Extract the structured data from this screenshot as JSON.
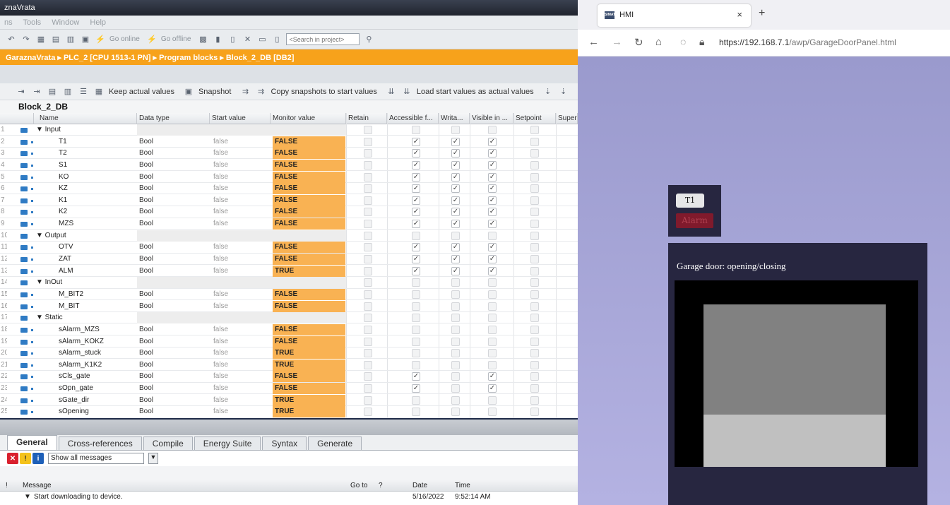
{
  "tia": {
    "title": "znaVrata",
    "menu": [
      "ns",
      "Tools",
      "Window",
      "Help"
    ],
    "toolbar": {
      "go_online": "Go online",
      "go_offline": "Go offline",
      "search_placeholder": "<Search in project>"
    },
    "breadcrumb": "GaraznaVrata  ▸  PLC_2 [CPU 1513-1 PN]  ▸  Program blocks  ▸  Block_2_DB [DB2]",
    "toolbar2": {
      "keep": "Keep actual values",
      "snapshot": "Snapshot",
      "copy": "Copy snapshots to start values",
      "load": "Load start values as actual values"
    },
    "block_name": "Block_2_DB",
    "columns": [
      "Name",
      "Data type",
      "Start value",
      "Monitor value",
      "Retain",
      "Accessible f...",
      "Writa...",
      "Visible in ...",
      "Setpoint",
      "Super"
    ],
    "rows": [
      {
        "n": "1",
        "name": "▼  Input",
        "group": true
      },
      {
        "n": "2",
        "name": "T1",
        "type": "Bool",
        "start": "false",
        "mon": "FALSE",
        "acc": true,
        "wr": true,
        "vis": true
      },
      {
        "n": "3",
        "name": "T2",
        "type": "Bool",
        "start": "false",
        "mon": "FALSE",
        "acc": true,
        "wr": true,
        "vis": true
      },
      {
        "n": "4",
        "name": "S1",
        "type": "Bool",
        "start": "false",
        "mon": "FALSE",
        "acc": true,
        "wr": true,
        "vis": true
      },
      {
        "n": "5",
        "name": "KO",
        "type": "Bool",
        "start": "false",
        "mon": "FALSE",
        "acc": true,
        "wr": true,
        "vis": true
      },
      {
        "n": "6",
        "name": "KZ",
        "type": "Bool",
        "start": "false",
        "mon": "FALSE",
        "acc": true,
        "wr": true,
        "vis": true
      },
      {
        "n": "7",
        "name": "K1",
        "type": "Bool",
        "start": "false",
        "mon": "FALSE",
        "acc": true,
        "wr": true,
        "vis": true
      },
      {
        "n": "8",
        "name": "K2",
        "type": "Bool",
        "start": "false",
        "mon": "FALSE",
        "acc": true,
        "wr": true,
        "vis": true
      },
      {
        "n": "9",
        "name": "MZS",
        "type": "Bool",
        "start": "false",
        "mon": "FALSE",
        "acc": true,
        "wr": true,
        "vis": true
      },
      {
        "n": "10",
        "name": "▼  Output",
        "group": true
      },
      {
        "n": "11",
        "name": "OTV",
        "type": "Bool",
        "start": "false",
        "mon": "FALSE",
        "acc": true,
        "wr": true,
        "vis": true
      },
      {
        "n": "12",
        "name": "ZAT",
        "type": "Bool",
        "start": "false",
        "mon": "FALSE",
        "acc": true,
        "wr": true,
        "vis": true
      },
      {
        "n": "13",
        "name": "ALM",
        "type": "Bool",
        "start": "false",
        "mon": "TRUE",
        "acc": true,
        "wr": true,
        "vis": true
      },
      {
        "n": "14",
        "name": "▼  InOut",
        "group": true
      },
      {
        "n": "15",
        "name": "M_BIT2",
        "type": "Bool",
        "start": "false",
        "mon": "FALSE"
      },
      {
        "n": "16",
        "name": "M_BIT",
        "type": "Bool",
        "start": "false",
        "mon": "FALSE"
      },
      {
        "n": "17",
        "name": "▼  Static",
        "group": true
      },
      {
        "n": "18",
        "name": "sAlarm_MZS",
        "type": "Bool",
        "start": "false",
        "mon": "FALSE"
      },
      {
        "n": "19",
        "name": "sAlarm_KOKZ",
        "type": "Bool",
        "start": "false",
        "mon": "FALSE"
      },
      {
        "n": "20",
        "name": "sAlarm_stuck",
        "type": "Bool",
        "start": "false",
        "mon": "TRUE"
      },
      {
        "n": "21",
        "name": "sAlarm_K1K2",
        "type": "Bool",
        "start": "false",
        "mon": "TRUE"
      },
      {
        "n": "22",
        "name": "sCls_gate",
        "type": "Bool",
        "start": "false",
        "mon": "FALSE",
        "acc": true,
        "vis": true
      },
      {
        "n": "23",
        "name": "sOpn_gate",
        "type": "Bool",
        "start": "false",
        "mon": "FALSE",
        "acc": true,
        "vis": true
      },
      {
        "n": "24",
        "name": "sGate_dir",
        "type": "Bool",
        "start": "false",
        "mon": "TRUE"
      },
      {
        "n": "25",
        "name": "sOpening",
        "type": "Bool",
        "start": "false",
        "mon": "TRUE"
      }
    ],
    "tabs": [
      "General",
      "Cross-references",
      "Compile",
      "Energy Suite",
      "Syntax",
      "Generate"
    ],
    "filter": "Show all messages",
    "msg_head": {
      "bang": "!",
      "message": "Message",
      "goto": "Go to",
      "q": "?",
      "date": "Date",
      "time": "Time"
    },
    "msg_row": {
      "text": "Start downloading to device.",
      "date": "5/16/2022",
      "time": "9:52:14 AM"
    }
  },
  "browser": {
    "tab_title": "HMI",
    "favicon": "SIMATIC",
    "close": "×",
    "new_tab": "+",
    "url_main": "https://192.168.7.1",
    "url_path": "/awp/GarageDoorPanel.html"
  },
  "hmi": {
    "t1_label": "T1",
    "alarm_label": "Alarm",
    "status_text": "Garage door: opening/closing",
    "colors": {
      "panel": "#272640",
      "alarm": "#801a2c",
      "door": "#818181",
      "floor": "#c0c0c0"
    }
  }
}
